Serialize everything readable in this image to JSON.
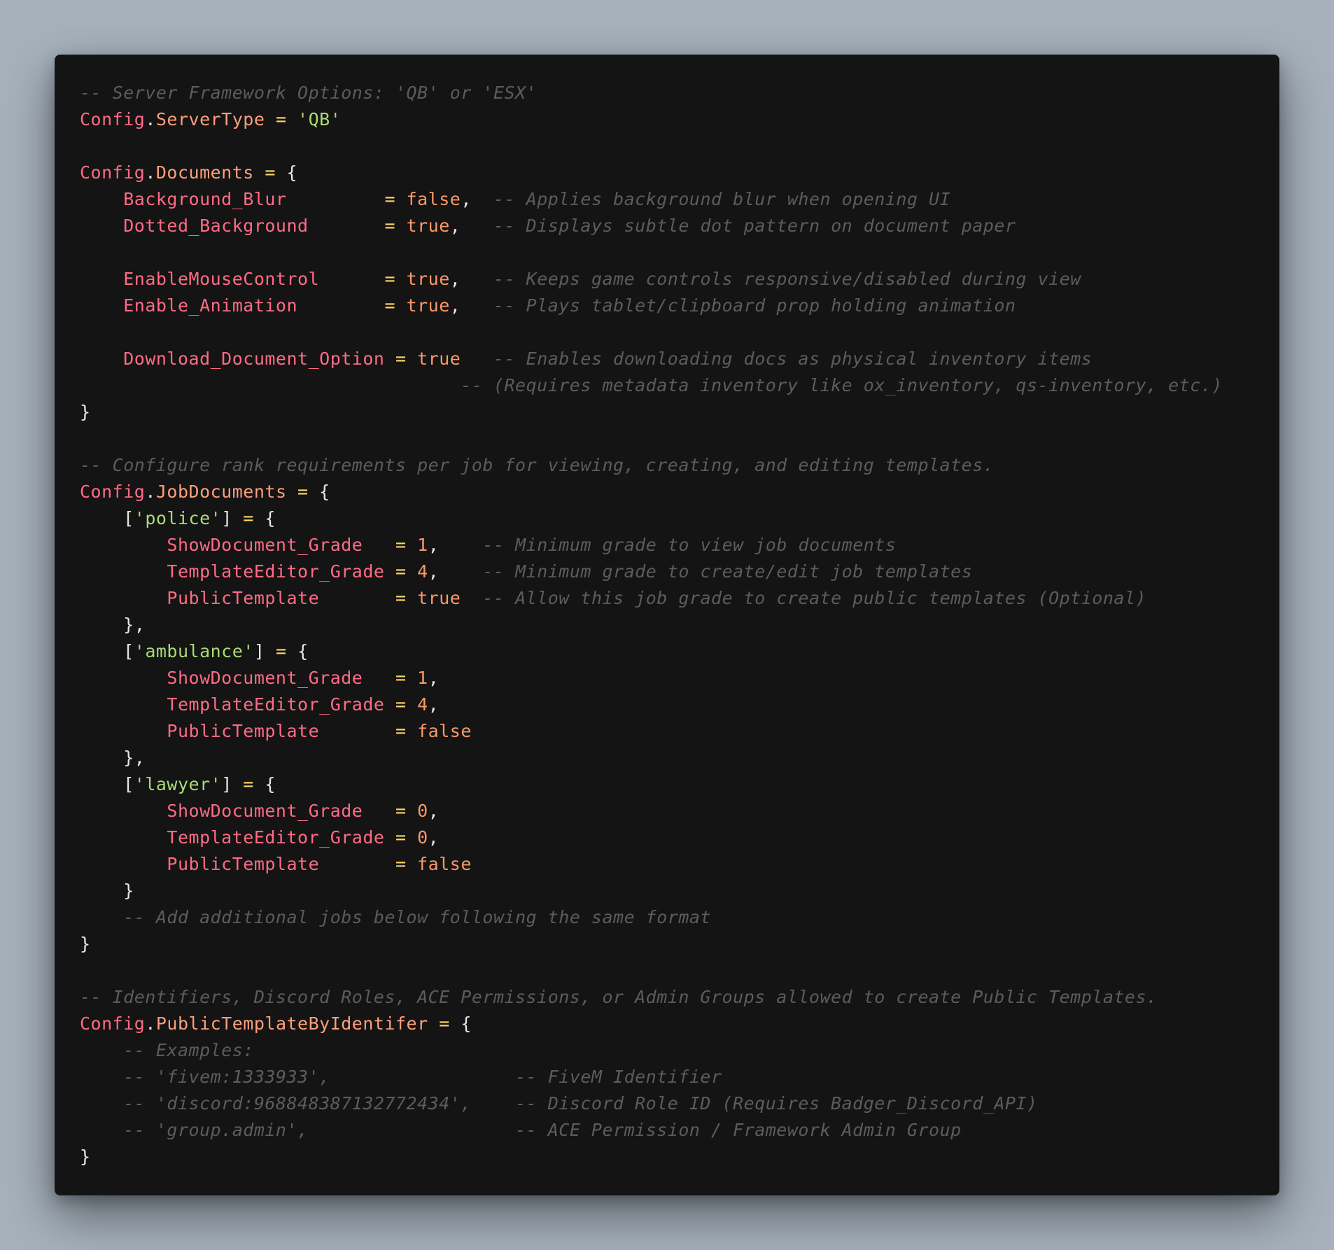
{
  "colors": {
    "background": "#a6b1bc",
    "editor_background": "#141414",
    "namespace": "#ff6b85",
    "member": "#ff9f7a",
    "key": "#ff6b85",
    "operator": "#ffd866",
    "string": "#a9dc76",
    "number": "#fc9867",
    "boolean": "#fc9867",
    "comment": "#5c5c5c",
    "plain": "#e6e6e6"
  },
  "code_lines": [
    [
      [
        "comment",
        "-- Server Framework Options: 'QB' or 'ESX'"
      ]
    ],
    [
      [
        "ns",
        "Config"
      ],
      [
        "plain",
        "."
      ],
      [
        "member",
        "ServerType"
      ],
      [
        "op",
        " = "
      ],
      [
        "str",
        "'QB'"
      ]
    ],
    [],
    [
      [
        "ns",
        "Config"
      ],
      [
        "plain",
        "."
      ],
      [
        "member",
        "Documents"
      ],
      [
        "op",
        " = "
      ],
      [
        "plain",
        "{"
      ]
    ],
    [
      [
        "plain",
        "    "
      ],
      [
        "key",
        "Background_Blur"
      ],
      [
        "op",
        "         = "
      ],
      [
        "bool",
        "false"
      ],
      [
        "plain",
        ",  "
      ],
      [
        "comment",
        "-- Applies background blur when opening UI"
      ]
    ],
    [
      [
        "plain",
        "    "
      ],
      [
        "key",
        "Dotted_Background"
      ],
      [
        "op",
        "       = "
      ],
      [
        "bool",
        "true"
      ],
      [
        "plain",
        ",   "
      ],
      [
        "comment",
        "-- Displays subtle dot pattern on document paper"
      ]
    ],
    [],
    [
      [
        "plain",
        "    "
      ],
      [
        "key",
        "EnableMouseControl"
      ],
      [
        "op",
        "      = "
      ],
      [
        "bool",
        "true"
      ],
      [
        "plain",
        ",   "
      ],
      [
        "comment",
        "-- Keeps game controls responsive/disabled during view"
      ]
    ],
    [
      [
        "plain",
        "    "
      ],
      [
        "key",
        "Enable_Animation"
      ],
      [
        "op",
        "        = "
      ],
      [
        "bool",
        "true"
      ],
      [
        "plain",
        ",   "
      ],
      [
        "comment",
        "-- Plays tablet/clipboard prop holding animation"
      ]
    ],
    [],
    [
      [
        "plain",
        "    "
      ],
      [
        "key",
        "Download_Document_Option"
      ],
      [
        "op",
        " = "
      ],
      [
        "bool",
        "true"
      ],
      [
        "plain",
        "   "
      ],
      [
        "comment",
        "-- Enables downloading docs as physical inventory items"
      ]
    ],
    [
      [
        "plain",
        "                                   "
      ],
      [
        "comment",
        "-- (Requires metadata inventory like ox_inventory, qs-inventory, etc.)"
      ]
    ],
    [
      [
        "plain",
        "}"
      ]
    ],
    [],
    [
      [
        "comment",
        "-- Configure rank requirements per job for viewing, creating, and editing templates."
      ]
    ],
    [
      [
        "ns",
        "Config"
      ],
      [
        "plain",
        "."
      ],
      [
        "member",
        "JobDocuments"
      ],
      [
        "op",
        " = "
      ],
      [
        "plain",
        "{"
      ]
    ],
    [
      [
        "plain",
        "    ["
      ],
      [
        "str",
        "'police'"
      ],
      [
        "plain",
        "]"
      ],
      [
        "op",
        " = "
      ],
      [
        "plain",
        "{"
      ]
    ],
    [
      [
        "plain",
        "        "
      ],
      [
        "key",
        "ShowDocument_Grade"
      ],
      [
        "op",
        "   = "
      ],
      [
        "num",
        "1"
      ],
      [
        "plain",
        ",    "
      ],
      [
        "comment",
        "-- Minimum grade to view job documents"
      ]
    ],
    [
      [
        "plain",
        "        "
      ],
      [
        "key",
        "TemplateEditor_Grade"
      ],
      [
        "op",
        " = "
      ],
      [
        "num",
        "4"
      ],
      [
        "plain",
        ",    "
      ],
      [
        "comment",
        "-- Minimum grade to create/edit job templates"
      ]
    ],
    [
      [
        "plain",
        "        "
      ],
      [
        "key",
        "PublicTemplate"
      ],
      [
        "op",
        "       = "
      ],
      [
        "bool",
        "true"
      ],
      [
        "plain",
        "  "
      ],
      [
        "comment",
        "-- Allow this job grade to create public templates (Optional)"
      ]
    ],
    [
      [
        "plain",
        "    },"
      ]
    ],
    [
      [
        "plain",
        "    ["
      ],
      [
        "str",
        "'ambulance'"
      ],
      [
        "plain",
        "]"
      ],
      [
        "op",
        " = "
      ],
      [
        "plain",
        "{"
      ]
    ],
    [
      [
        "plain",
        "        "
      ],
      [
        "key",
        "ShowDocument_Grade"
      ],
      [
        "op",
        "   = "
      ],
      [
        "num",
        "1"
      ],
      [
        "plain",
        ","
      ]
    ],
    [
      [
        "plain",
        "        "
      ],
      [
        "key",
        "TemplateEditor_Grade"
      ],
      [
        "op",
        " = "
      ],
      [
        "num",
        "4"
      ],
      [
        "plain",
        ","
      ]
    ],
    [
      [
        "plain",
        "        "
      ],
      [
        "key",
        "PublicTemplate"
      ],
      [
        "op",
        "       = "
      ],
      [
        "bool",
        "false"
      ]
    ],
    [
      [
        "plain",
        "    },"
      ]
    ],
    [
      [
        "plain",
        "    ["
      ],
      [
        "str",
        "'lawyer'"
      ],
      [
        "plain",
        "]"
      ],
      [
        "op",
        " = "
      ],
      [
        "plain",
        "{"
      ]
    ],
    [
      [
        "plain",
        "        "
      ],
      [
        "key",
        "ShowDocument_Grade"
      ],
      [
        "op",
        "   = "
      ],
      [
        "num",
        "0"
      ],
      [
        "plain",
        ","
      ]
    ],
    [
      [
        "plain",
        "        "
      ],
      [
        "key",
        "TemplateEditor_Grade"
      ],
      [
        "op",
        " = "
      ],
      [
        "num",
        "0"
      ],
      [
        "plain",
        ","
      ]
    ],
    [
      [
        "plain",
        "        "
      ],
      [
        "key",
        "PublicTemplate"
      ],
      [
        "op",
        "       = "
      ],
      [
        "bool",
        "false"
      ]
    ],
    [
      [
        "plain",
        "    }"
      ]
    ],
    [
      [
        "plain",
        "    "
      ],
      [
        "comment",
        "-- Add additional jobs below following the same format"
      ]
    ],
    [
      [
        "plain",
        "}"
      ]
    ],
    [],
    [
      [
        "comment",
        "-- Identifiers, Discord Roles, ACE Permissions, or Admin Groups allowed to create Public Templates."
      ]
    ],
    [
      [
        "ns",
        "Config"
      ],
      [
        "plain",
        "."
      ],
      [
        "member",
        "PublicTemplateByIdentifer"
      ],
      [
        "op",
        " = "
      ],
      [
        "plain",
        "{"
      ]
    ],
    [
      [
        "plain",
        "    "
      ],
      [
        "comment",
        "-- Examples:"
      ]
    ],
    [
      [
        "plain",
        "    "
      ],
      [
        "comment",
        "-- 'fivem:1333933',                 -- FiveM Identifier"
      ]
    ],
    [
      [
        "plain",
        "    "
      ],
      [
        "comment",
        "-- 'discord:968848387132772434',    -- Discord Role ID (Requires Badger_Discord_API)"
      ]
    ],
    [
      [
        "plain",
        "    "
      ],
      [
        "comment",
        "-- 'group.admin',                   -- ACE Permission / Framework Admin Group"
      ]
    ],
    [
      [
        "plain",
        "}"
      ]
    ]
  ]
}
